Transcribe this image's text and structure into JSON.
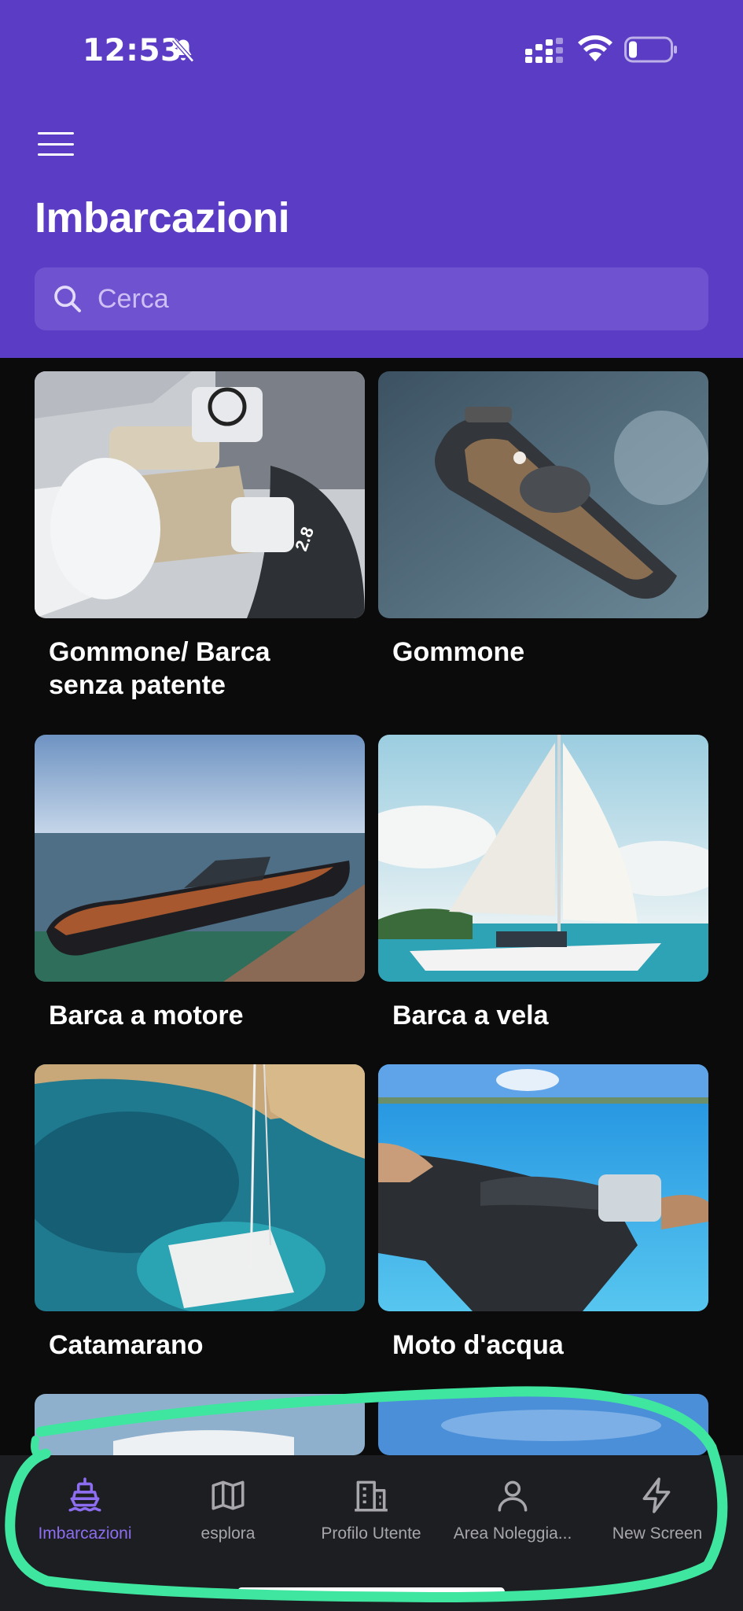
{
  "status_bar": {
    "time": "12:53"
  },
  "header": {
    "title": "Imbarcazioni",
    "search_placeholder": "Cerca"
  },
  "categories": [
    {
      "label": "Gommone/ Barca senza patente"
    },
    {
      "label": "Gommone"
    },
    {
      "label": "Barca a motore"
    },
    {
      "label": "Barca a vela"
    },
    {
      "label": "Catamarano"
    },
    {
      "label": "Moto d'acqua"
    }
  ],
  "bottom_nav": {
    "items": [
      {
        "label": "Imbarcazioni",
        "icon": "boat-icon",
        "active": true
      },
      {
        "label": "esplora",
        "icon": "map-icon",
        "active": false
      },
      {
        "label": "Profilo Utente",
        "icon": "building-icon",
        "active": false
      },
      {
        "label": "Area Noleggia...",
        "icon": "person-icon",
        "active": false
      },
      {
        "label": "New Screen",
        "icon": "bolt-icon",
        "active": false
      }
    ]
  },
  "colors": {
    "header_bg": "#5b3cc4",
    "search_bg": "#6f52cf",
    "active_tab": "#8d6df0",
    "annotation": "#3fe6a0"
  }
}
